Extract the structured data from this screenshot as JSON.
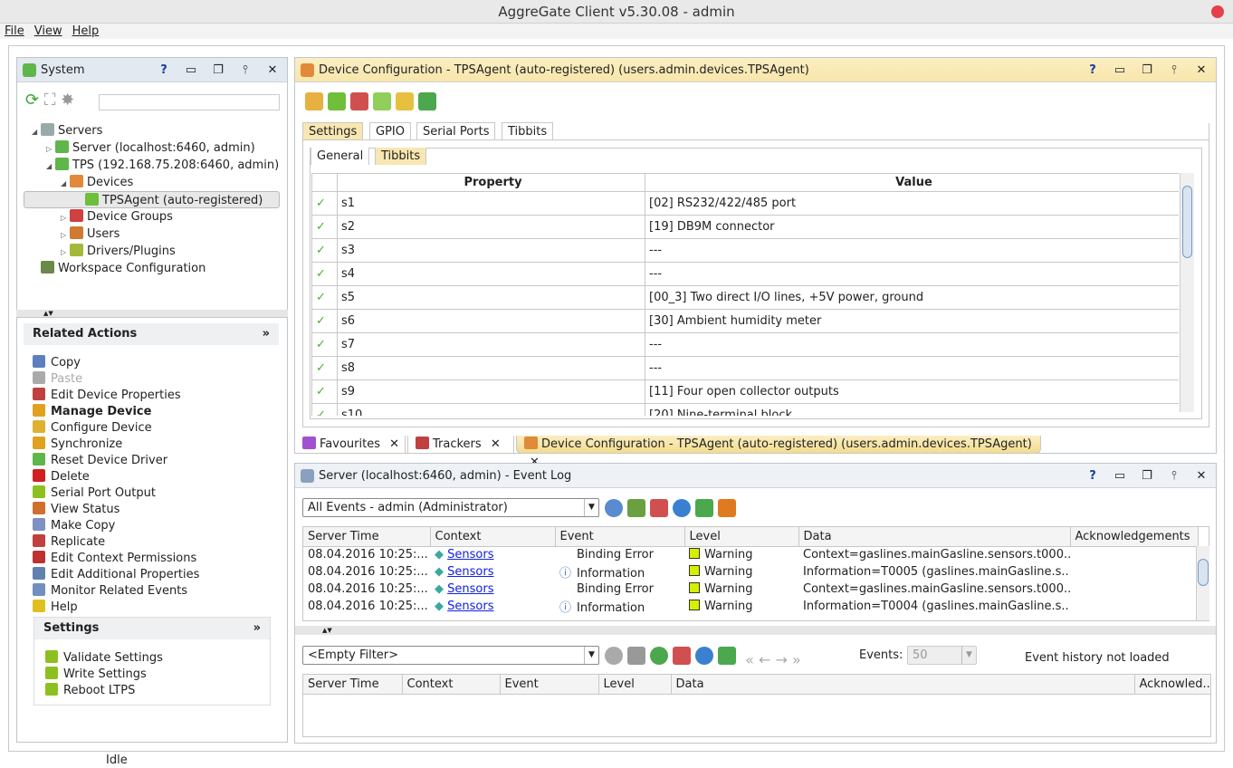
{
  "window": {
    "title": "AggreGate Client v5.30.08 - admin"
  },
  "menu": [
    "File",
    "View",
    "Help"
  ],
  "system_panel": {
    "title": "System",
    "search_placeholder": "",
    "tree": [
      {
        "label": "Servers",
        "indent": 0,
        "expanded": true,
        "color": "#9aa"
      },
      {
        "label": "Server (localhost:6460, admin)",
        "indent": 1,
        "expanded": false,
        "color": "#5fb64a"
      },
      {
        "label": "TPS (192.168.75.208:6460, admin)",
        "indent": 1,
        "expanded": true,
        "color": "#5fb64a"
      },
      {
        "label": "Devices",
        "indent": 2,
        "expanded": true,
        "color": "#e08a3a"
      },
      {
        "label": "TPSAgent (auto-registered)",
        "indent": 3,
        "selected": true,
        "color": "#6fbf3a"
      },
      {
        "label": "Device Groups",
        "indent": 2,
        "expanded": false,
        "color": "#d04040"
      },
      {
        "label": "Users",
        "indent": 2,
        "expanded": false,
        "color": "#d07a30"
      },
      {
        "label": "Drivers/Plugins",
        "indent": 2,
        "expanded": false,
        "color": "#a6b83a"
      },
      {
        "label": "Workspace Configuration",
        "indent": 0,
        "color": "#6a8a4a"
      }
    ]
  },
  "related_actions": {
    "title": "Related Actions",
    "items": [
      {
        "label": "Copy",
        "color": "#5c7fbf"
      },
      {
        "label": "Paste",
        "disabled": true,
        "color": "#aaa"
      },
      {
        "label": "Edit Device Properties",
        "color": "#c04040"
      },
      {
        "label": "Manage Device",
        "bold": true,
        "color": "#e0a020"
      },
      {
        "label": "Configure Device",
        "color": "#e0b030"
      },
      {
        "label": "Synchronize",
        "color": "#e0a020"
      },
      {
        "label": "Reset Device Driver",
        "color": "#5fb64a"
      },
      {
        "label": "Delete",
        "color": "#d02020"
      },
      {
        "label": "Serial Port Output",
        "color": "#8cc020"
      },
      {
        "label": "View Status",
        "color": "#d07030"
      },
      {
        "label": "Make Copy",
        "color": "#8090c0"
      },
      {
        "label": "Replicate",
        "color": "#c04040"
      },
      {
        "label": "Edit Context Permissions",
        "color": "#c03030"
      },
      {
        "label": "Edit Additional Properties",
        "color": "#6080b0"
      },
      {
        "label": "Monitor Related Events",
        "color": "#7090c0"
      },
      {
        "label": "Help",
        "color": "#e0c020"
      }
    ]
  },
  "settings": {
    "title": "Settings",
    "items": [
      "Validate Settings",
      "Write Settings",
      "Reboot LTPS"
    ]
  },
  "device_config": {
    "title": "Device Configuration - TPSAgent (auto-registered) (users.admin.devices.TPSAgent)",
    "tabs": [
      "Settings",
      "GPIO",
      "Serial Ports",
      "Tibbits"
    ],
    "active_tab": "Settings",
    "subtabs": [
      "General",
      "Tibbits"
    ],
    "active_subtab": "Tibbits",
    "columns": [
      "Property",
      "Value"
    ],
    "rows": [
      [
        "s1",
        "[02] RS232/422/485 port"
      ],
      [
        "s2",
        "[19] DB9M connector"
      ],
      [
        "s3",
        "---"
      ],
      [
        "s4",
        "---"
      ],
      [
        "s5",
        "[00_3] Two direct I/O lines, +5V power, ground"
      ],
      [
        "s6",
        "[30] Ambient humidity meter"
      ],
      [
        "s7",
        "---"
      ],
      [
        "s8",
        "---"
      ],
      [
        "s9",
        "[11] Four open collector outputs"
      ],
      [
        "s10",
        "[20] Nine-terminal block"
      ]
    ]
  },
  "bottom_tabs": [
    {
      "label": "Favourites"
    },
    {
      "label": "Trackers"
    },
    {
      "label": "Device Configuration - TPSAgent (auto-registered) (users.admin.devices.TPSAgent)",
      "active": true
    }
  ],
  "event_log": {
    "title": "Server (localhost:6460, admin) - Event Log",
    "filter": "All Events - admin (Administrator)",
    "columns": [
      "Server Time",
      "Context",
      "Event",
      "Level",
      "Data",
      "Acknowledgements"
    ],
    "rows": [
      {
        "time": "08.04.2016 10:25:...",
        "context": "Sensors",
        "event": "Binding Error",
        "info_icon": false,
        "level": "Warning",
        "data": "Context=gaslines.mainGasline.sensors.t000..."
      },
      {
        "time": "08.04.2016 10:25:...",
        "context": "Sensors",
        "event": "Information",
        "info_icon": true,
        "level": "Warning",
        "data": "Information=T0005 (gaslines.mainGasline.s..."
      },
      {
        "time": "08.04.2016 10:25:...",
        "context": "Sensors",
        "event": "Binding Error",
        "info_icon": false,
        "level": "Warning",
        "data": "Context=gaslines.mainGasline.sensors.t000..."
      },
      {
        "time": "08.04.2016 10:25:...",
        "context": "Sensors",
        "event": "Information",
        "info_icon": true,
        "level": "Warning",
        "data": "Information=T0004 (gaslines.mainGasline.s..."
      }
    ],
    "history_filter": "<Empty Filter>",
    "events_label": "Events:",
    "events_value": "50",
    "history_status": "Event history not loaded",
    "history_columns": [
      "Server Time",
      "Context",
      "Event",
      "Level",
      "Data",
      "Acknowled..."
    ]
  },
  "status": "Idle",
  "colors": {
    "warning": "#d4f000",
    "link": "#1020e0",
    "selected_tab": "#f8e7b2"
  }
}
